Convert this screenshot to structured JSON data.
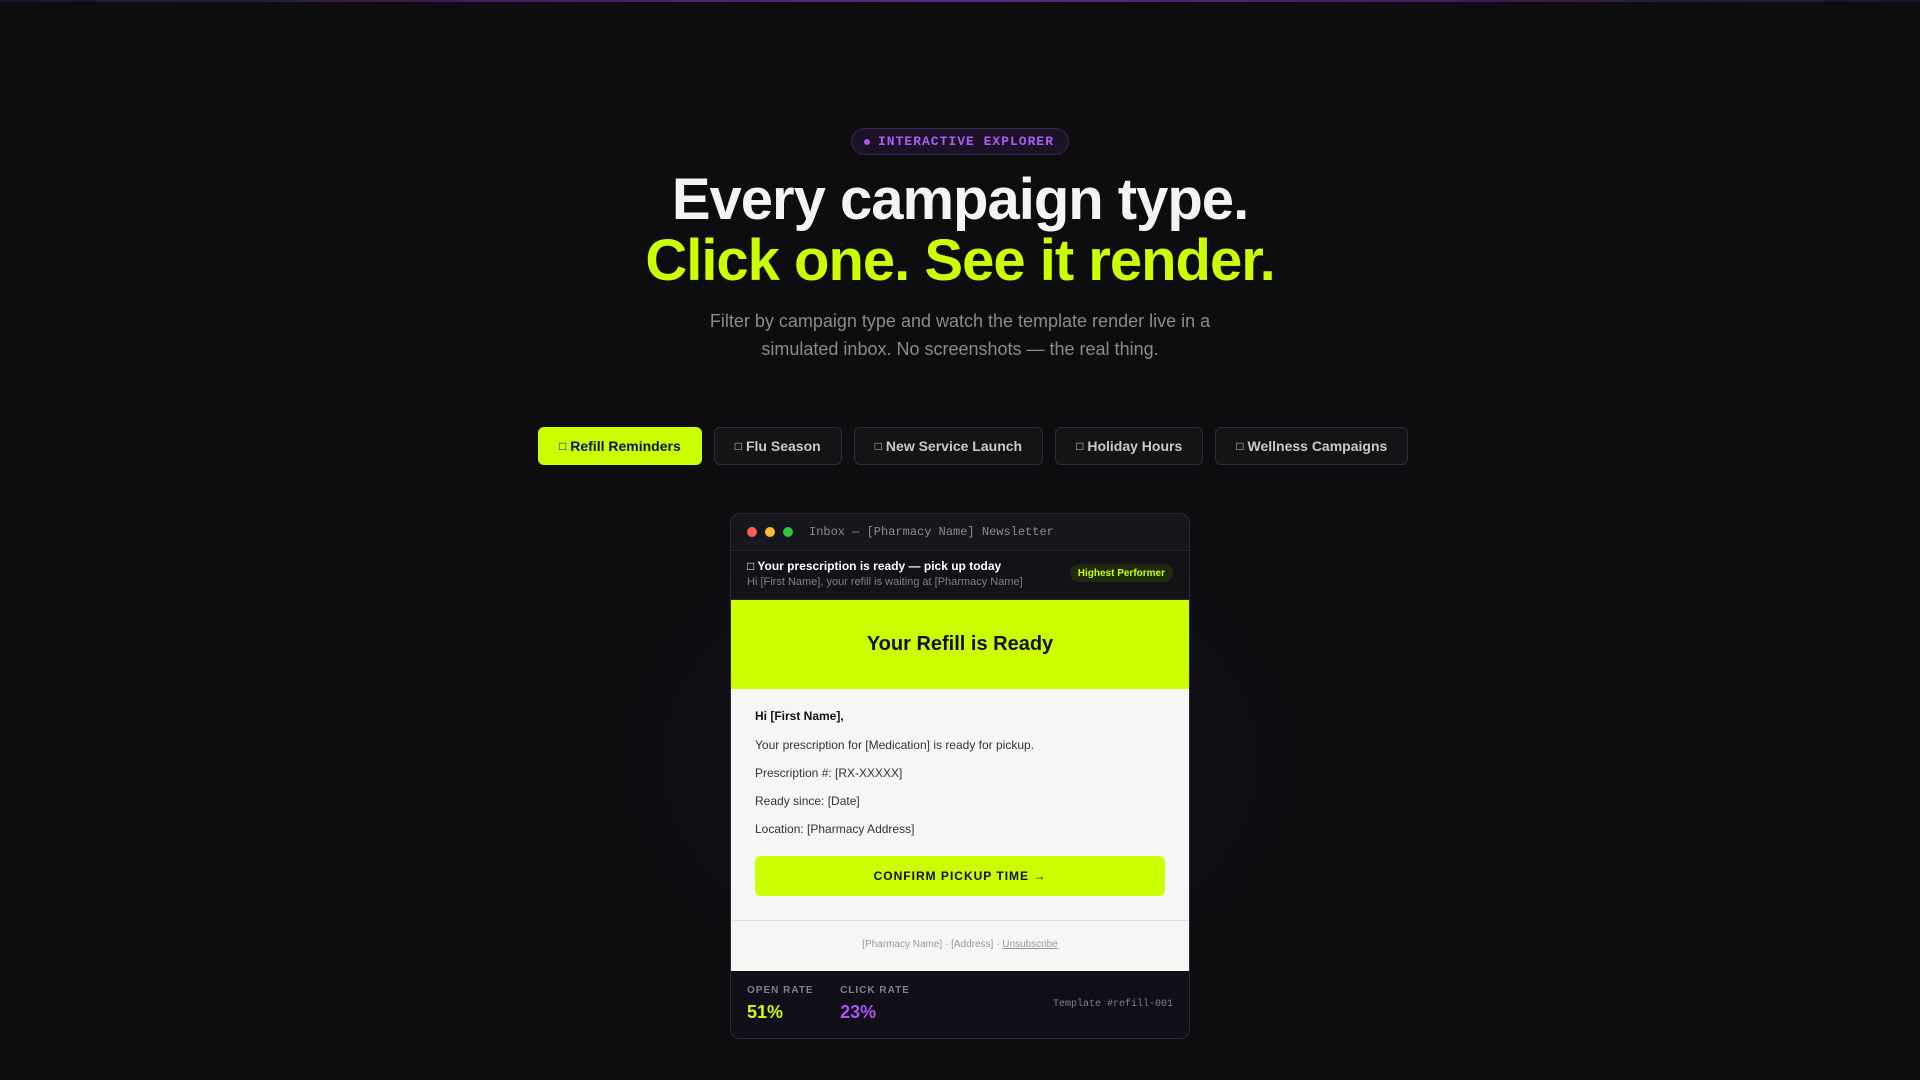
{
  "hero": {
    "badge": "INTERACTIVE EXPLORER",
    "headline_1": "Every campaign type.",
    "headline_2": "Click one. See it render.",
    "subtitle": "Filter by campaign type and watch the template render live in a simulated inbox. No screenshots — the real thing."
  },
  "tabs": [
    {
      "icon": "□",
      "label": "Refill Reminders",
      "active": true
    },
    {
      "icon": "□",
      "label": "Flu Season",
      "active": false
    },
    {
      "icon": "□",
      "label": "New Service Launch",
      "active": false
    },
    {
      "icon": "□",
      "label": "Holiday Hours",
      "active": false
    },
    {
      "icon": "□",
      "label": "Wellness Campaigns",
      "active": false
    }
  ],
  "inbox": {
    "window_title": "Inbox — [Pharmacy Name] Newsletter",
    "subject_icon": "□",
    "subject": "Your prescription is ready — pick up today",
    "preview": "Hi [First Name], your refill is waiting at [Pharmacy Name]",
    "badge": "Highest Performer"
  },
  "email": {
    "header": "Your Refill is Ready",
    "greeting": "Hi [First Name],",
    "line1": "Your prescription for [Medication] is ready for pickup.",
    "line2": "Prescription #: [RX-XXXXX]",
    "line3": "Ready since: [Date]",
    "line4": "Location: [Pharmacy Address]",
    "cta": "CONFIRM PICKUP TIME →",
    "footer_text": "[Pharmacy Name] · [Address] · ",
    "unsubscribe": "Unsubscribe"
  },
  "stats": {
    "open_label": "OPEN RATE",
    "open_value": "51%",
    "click_label": "CLICK RATE",
    "click_value": "23%",
    "template_id": "Template #refill-001"
  },
  "colors": {
    "accent": "#ccff00",
    "purple": "#a855f7",
    "dot_red": "#ff5f57",
    "dot_yellow": "#febc2e",
    "dot_green": "#28c840"
  }
}
